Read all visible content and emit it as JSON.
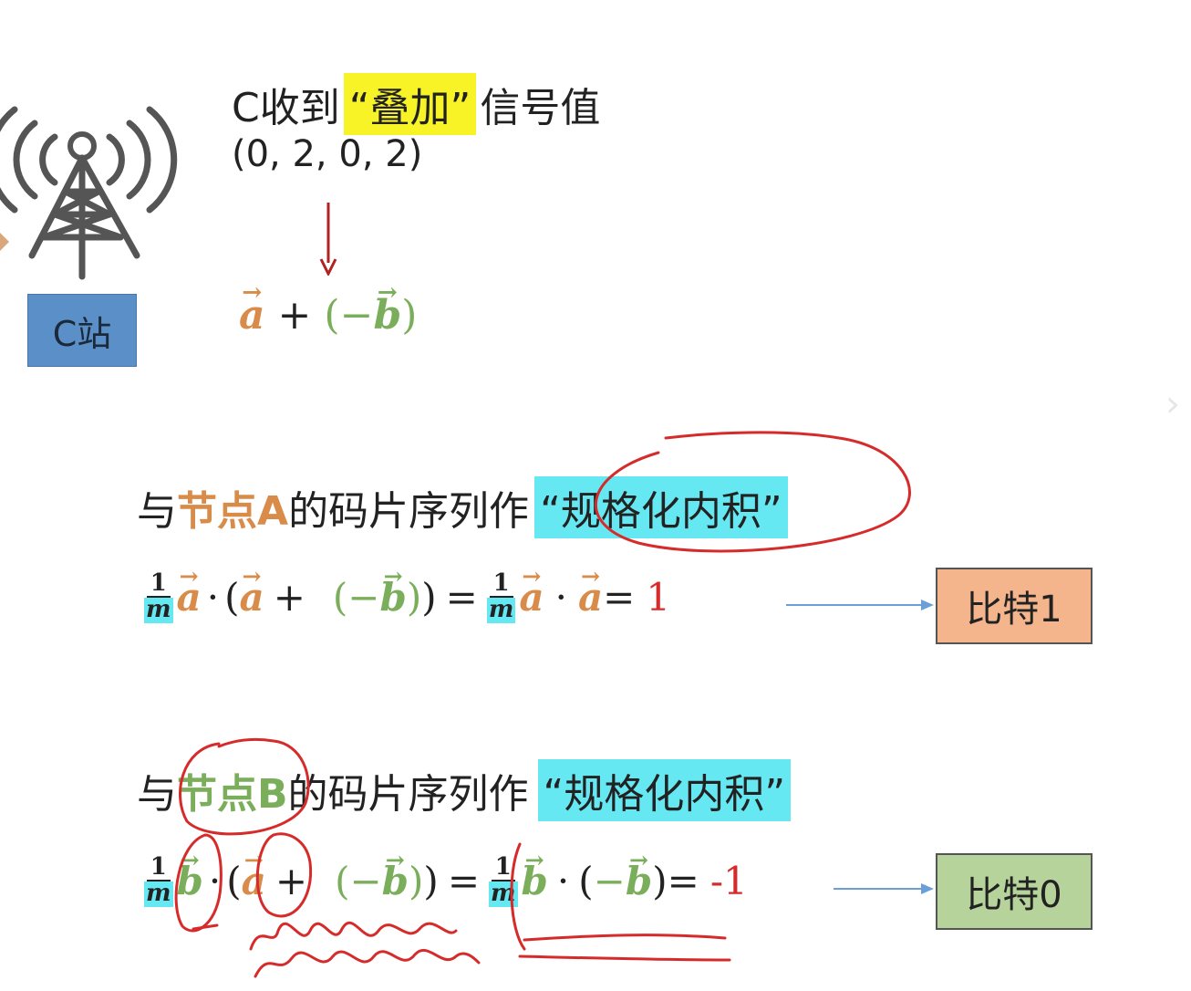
{
  "station": {
    "label": "C站",
    "icon": "radio-tower-icon"
  },
  "received": {
    "prefix": "C收到",
    "highlight": "“叠加”",
    "suffix": "信号值",
    "values": "(0, 2, 0, 2)"
  },
  "sum_expression": {
    "a": "a",
    "plus": "+",
    "open": "(",
    "minus": "−",
    "b": "b",
    "close": ")"
  },
  "section_a": {
    "prefix": "与",
    "node": "节点A",
    "middle": "的码片序列作",
    "highlight": "“规格化内积”",
    "fraction_num": "1",
    "fraction_den": "m",
    "dot": "·",
    "eq": "=",
    "result_eq": "=",
    "result": "1",
    "box_label": "比特1"
  },
  "section_b": {
    "prefix": "与",
    "node": "节点B",
    "middle": "的码片序列作",
    "highlight": "“规格化内积”",
    "fraction_num": "1",
    "fraction_den": "m",
    "dot": "·",
    "eq": "=",
    "result_eq": "=",
    "result": "-1",
    "box_label": "比特0"
  },
  "colors": {
    "orange": "#d98c4a",
    "green": "#7aae5a",
    "yellow_highlight": "#f7f326",
    "cyan_highlight": "#66e8f3",
    "annotation_red": "#d62b2b",
    "arrow_blue": "#6a9fd8",
    "station_blue": "#5b8fc7",
    "bit1_box": "#f4b58d",
    "bit0_box": "#b5d39a"
  }
}
